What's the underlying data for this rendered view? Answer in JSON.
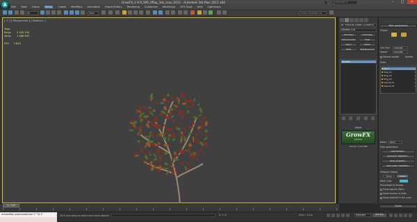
{
  "app": {
    "window_title": "GrowFX_1.9.9_SP8_VRay_3ds_max_2011 - Autodesk 3ds Max 2011 x64",
    "search_placeholder": "Type a keyword or phrase",
    "logo_text": "A"
  },
  "menu": [
    "Edit",
    "Tools",
    "Group",
    "Views",
    "Create",
    "Modifiers",
    "Animation",
    "Graph Editors",
    "Rendering",
    "Customize",
    "MAXScript",
    "GFX Tools",
    "Help",
    "Lightmaps"
  ],
  "toolbar": {
    "selection_filter": "All",
    "view_coord": "View",
    "selection_set": "Create Selection Se"
  },
  "viewport": {
    "label": "[ + ] [ Perspective ] [ Realistic ]",
    "stats": [
      {
        "label": "Total",
        "value": ""
      },
      {
        "label": "Polys:",
        "value": "2 395 230"
      },
      {
        "label": "Verts:",
        "value": "1 486 895"
      }
    ],
    "fps_label": "FPS:",
    "fps_value": "7.892"
  },
  "timeline": {
    "thumb": "0 / 100",
    "ticks": [
      "0",
      "5",
      "10",
      "15",
      "20",
      "25",
      "30",
      "35",
      "40",
      "45",
      "50",
      "55",
      "60",
      "65",
      "70",
      "75",
      "80",
      "85",
      "90",
      "95",
      "100"
    ]
  },
  "status": {
    "maxscript": "actionMan.executeAction 0 \"311\"",
    "prompt": "Click and drag to select and move objects",
    "coords": "X:   Y:   Z:",
    "grid": "Grid = 0,1m",
    "key_mode": "Selected",
    "set_key": "Set Key"
  },
  "command_panel": {
    "object_name": "BF Photinia Fraseri (GrowFX)",
    "modifier_list": "Modifier List",
    "buttons": [
      "Edit Poly",
      "UVW Map",
      "Turbosmooth",
      "Shell",
      "Bend",
      "Noise",
      "Shell",
      "Displacement"
    ],
    "stack_item": "GrowFX",
    "about_header": "About",
    "logo_text": "GrowFX",
    "logo_sub": "EXLEVEL",
    "version": "Version 1.9.9 SP8"
  },
  "growfx_panel": {
    "main_header": "Main parameters",
    "project_label": "Project",
    "icon_size_label": "Icon Size",
    "icon_size_value": "100,000",
    "speed_label": "Speed",
    "speed_value": "100,000",
    "manual_update": "Manual update",
    "update_btn": "Update",
    "paths_header": "Paths",
    "paths": [
      {
        "name": "Stem",
        "num": "1",
        "selected": true
      },
      {
        "name": "Twig_01",
        "num": "1"
      },
      {
        "name": "Twig_02",
        "num": "1"
      },
      {
        "name": "Twig_03",
        "num": "1"
      },
      {
        "name": "Leaves 01",
        "num": "1"
      },
      {
        "name": "Leaves 02",
        "num": "1"
      }
    ],
    "name_label": "Name",
    "name_value": "Stem",
    "path_params_header": "Path parameters",
    "distribution_btn": "Distribution...",
    "direction_mod_btn": "Direction Modifiers...",
    "mesh_builders_btn": "Mesh builders...",
    "after_mesh_btn": "After Mesh Modifiers...",
    "viewport_display_header": "Viewport display",
    "lines_label": "Lines",
    "mesh_label": "Mesh",
    "mesh_color_label": "Mesh color",
    "pct_label": "Percentage of display",
    "show_objects_label": "Show objects (Path)",
    "show_bbox_label": "Show number of leafs",
    "show_selected_label": "Show selected in the color",
    "cache_header": "Cache",
    "pref_header": "Preferences parameters"
  },
  "colors": {
    "selection_blue": "#6b8fb8",
    "viewport_border": "#e7c232",
    "stat_text": "#e1e17a",
    "mesh_color": "#46b8d5",
    "close_red": "#c63d32"
  }
}
